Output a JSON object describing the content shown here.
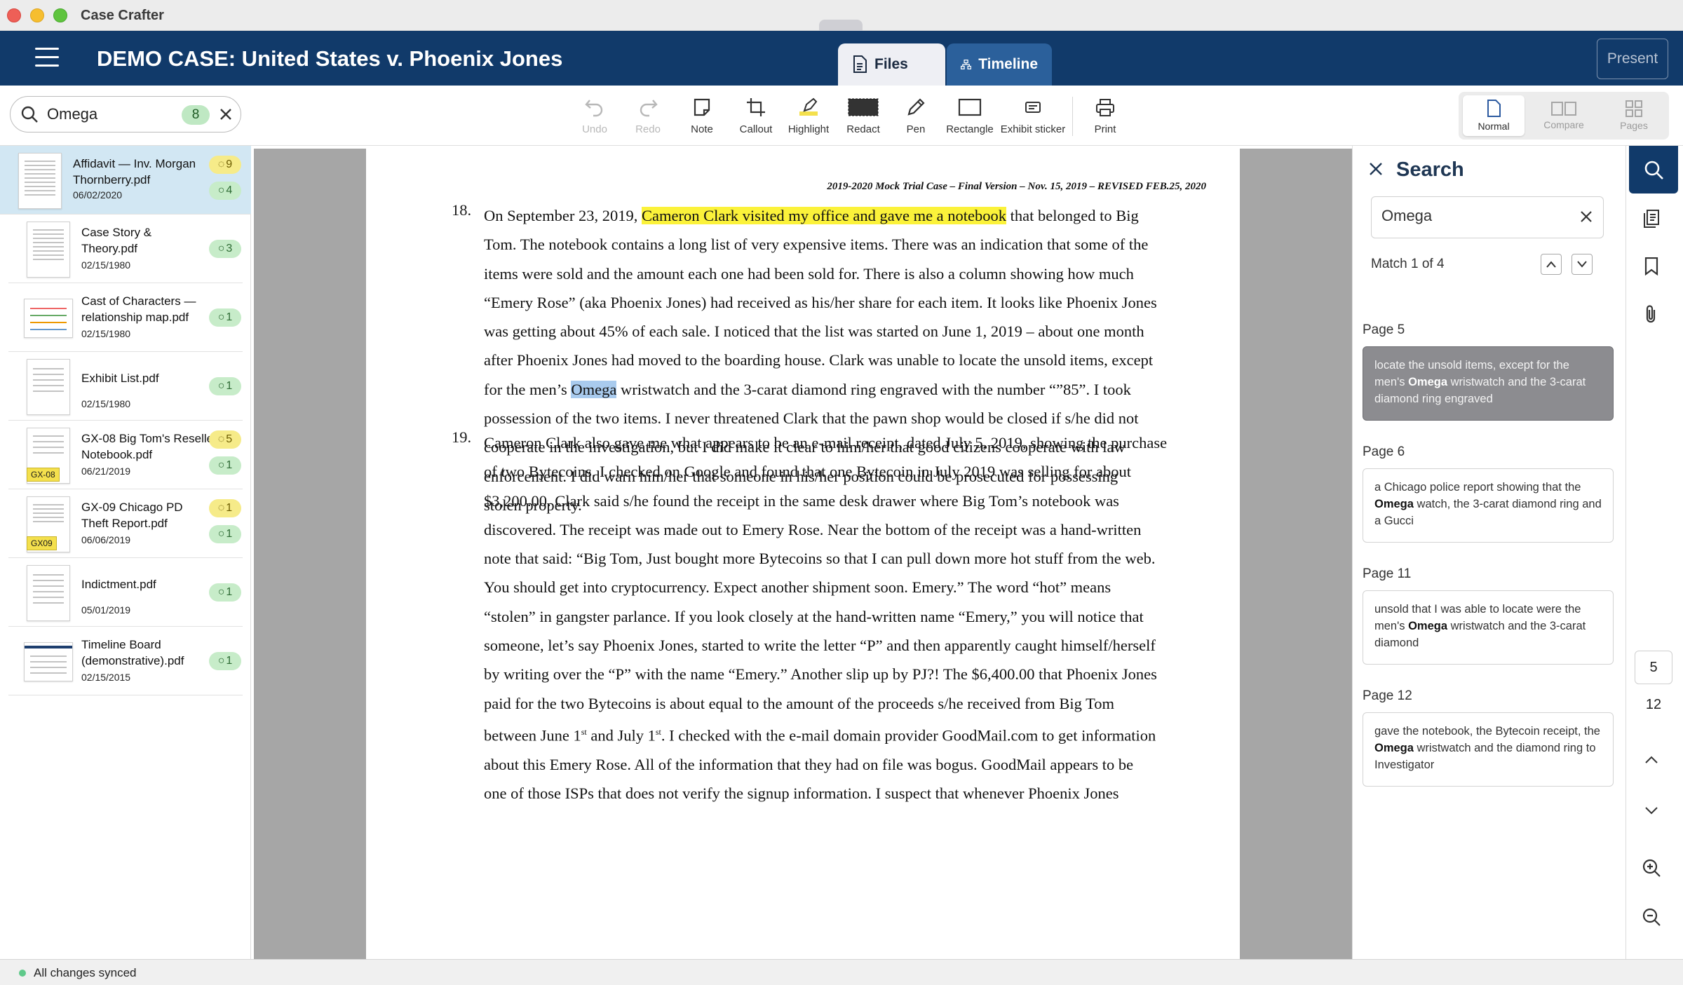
{
  "app": {
    "title": "Case Crafter"
  },
  "header": {
    "case_title": "DEMO CASE: United States v. Phoenix Jones",
    "tabs": [
      {
        "label": "Files",
        "active": true
      },
      {
        "label": "Timeline",
        "active": false
      }
    ],
    "present_label": "Present"
  },
  "file_search": {
    "value": "Omega",
    "count": "8"
  },
  "toolbar": {
    "tools": [
      {
        "label": "Undo",
        "icon": "undo-icon",
        "disabled": true
      },
      {
        "label": "Redo",
        "icon": "redo-icon",
        "disabled": true
      },
      {
        "label": "Note",
        "icon": "note-icon"
      },
      {
        "label": "Callout",
        "icon": "crop-icon"
      },
      {
        "label": "Highlight",
        "icon": "highlighter-icon"
      },
      {
        "label": "Redact",
        "icon": "redact-icon"
      },
      {
        "label": "Pen",
        "icon": "pen-icon"
      },
      {
        "label": "Rectangle",
        "icon": "rectangle-icon"
      },
      {
        "label": "Exhibit sticker",
        "icon": "sticker-icon"
      },
      {
        "label": "Print",
        "icon": "printer-icon"
      }
    ],
    "views": [
      {
        "label": "Normal",
        "active": true
      },
      {
        "label": "Compare",
        "active": false
      },
      {
        "label": "Pages",
        "active": false
      }
    ]
  },
  "files": [
    {
      "name": "Affidavit — Inv. Morgan Thornberry.pdf",
      "date": "06/02/2020",
      "badges": [
        {
          "kind": "yellow",
          "value": "9"
        },
        {
          "kind": "green",
          "value": "4"
        }
      ],
      "selected": true
    },
    {
      "name": "Case Story & Theory.pdf",
      "date": "02/15/1980",
      "badges": [
        {
          "kind": "green",
          "value": "3"
        }
      ]
    },
    {
      "name": "Cast of Characters — relationship map.pdf",
      "date": "02/15/1980",
      "badges": [
        {
          "kind": "green",
          "value": "1"
        }
      ]
    },
    {
      "name": "Exhibit List.pdf",
      "date": "02/15/1980",
      "badges": [
        {
          "kind": "green",
          "value": "1"
        }
      ]
    },
    {
      "name": "GX-08 Big Tom's Reseller Notebook.pdf",
      "date": "06/21/2019",
      "exhibit": "GX-08",
      "badges": [
        {
          "kind": "yellow",
          "value": "5"
        },
        {
          "kind": "green",
          "value": "1"
        }
      ]
    },
    {
      "name": "GX-09 Chicago PD Theft Report.pdf",
      "date": "06/06/2019",
      "exhibit": "GX09",
      "badges": [
        {
          "kind": "yellow",
          "value": "1"
        },
        {
          "kind": "green",
          "value": "1"
        }
      ]
    },
    {
      "name": "Indictment.pdf",
      "date": "05/01/2019",
      "badges": [
        {
          "kind": "green",
          "value": "1"
        }
      ]
    },
    {
      "name": "Timeline Board (demonstrative).pdf",
      "date": "02/15/2015",
      "badges": [
        {
          "kind": "green",
          "value": "1"
        }
      ]
    }
  ],
  "document": {
    "header": "2019-2020 Mock Trial Case – Final Version – Nov. 15, 2019 – REVISED FEB.25, 2020",
    "para18": {
      "number": "18.",
      "l1_pre": "On September 23, 2019, ",
      "l1_highlight": "Cameron Clark visited my office and gave me a notebook",
      "l1_post": " that belonged to Big",
      "l2": "Tom. The notebook contains a long list of very expensive items. There was an indication that some of the",
      "l3": "items were sold and the amount each one had been sold for. There is also a column showing how much",
      "l4": "“Emery Rose” (aka Phoenix Jones) had received as his/her share for each item. It looks like Phoenix Jones",
      "l5": "was getting about 45% of each sale. I noticed that the list was started on June 1, 2019 – about one month",
      "l6": "after Phoenix Jones had moved to the boarding house. Clark was unable to locate the unsold items, except",
      "l7_pre": "for the men’s ",
      "l7_match": "Omega",
      "l7_post": " wristwatch and the 3-carat diamond ring engraved with the number “”85”. I took",
      "l8": "possession of the two items. I never threatened Clark that the pawn shop would be closed if s/he did not",
      "l9": "cooperate in the investigation, but I did make it clear to him/her that good citizens cooperate with law",
      "l10": "enforcement. I did warn him/her that someone in his/her position could be prosecuted for possessing",
      "l11": "stolen property."
    },
    "para19": {
      "number": "19.",
      "l1": "Cameron Clark also gave me what appears to be an e-mail receipt, dated July 5, 2019, showing the purchase",
      "l2": "of two Bytecoins.  I checked on Google and found that one Bytecoin in July 2019 was selling for about",
      "l3": "$3,200.00.  Clark said s/he found the receipt in the same desk drawer where Big Tom’s notebook was",
      "l4": "discovered.  The receipt was made out to Emery Rose.  Near the bottom of the receipt was a hand-written",
      "l5": "note that said: “Big Tom, Just bought more Bytecoins so that I can pull down more hot stuff from the web.",
      "l6": "You should get into cryptocurrency. Expect another shipment soon. Emery.”  The word “hot” means",
      "l7": "“stolen” in gangster parlance.  If you look closely at the hand-written name “Emery,” you will notice that",
      "l8": "someone, let’s say Phoenix Jones, started to write the letter “P” and then apparently caught himself/herself",
      "l9": "by writing over the “P” with the name “Emery.”  Another slip up by PJ?!  The $6,400.00 that Phoenix Jones",
      "l10": "paid for the two Bytecoins is about equal to the amount of the proceeds s/he received from Big Tom",
      "l11_a": "between June 1",
      "l11_sup1": "st",
      "l11_b": " and July 1",
      "l11_sup2": "st",
      "l11_c": ".  I checked with the e-mail domain provider GoodMail.com to get information",
      "l12": "about this Emery Rose.  All of the information that they had on file was bogus.  GoodMail appears to be",
      "l13": "one of those ISPs that does not verify the signup information.  I suspect that whenever Phoenix Jones"
    }
  },
  "search_panel": {
    "title": "Search",
    "query": "Omega",
    "match_text": "Match 1 of 4",
    "results": [
      {
        "page": "Page 5",
        "pre": "locate the unsold items, except for the men's ",
        "match": "Omega",
        "post": " wristwatch and the 3-carat diamond ring engraved",
        "active": true
      },
      {
        "page": "Page 6",
        "pre": "a Chicago police report showing that the ",
        "match": "Omega",
        "post": " watch, the 3-carat diamond ring and a Gucci"
      },
      {
        "page": "Page 11",
        "pre": "unsold that I was able to locate were the men's ",
        "match": "Omega",
        "post": " wristwatch and the 3-carat diamond"
      },
      {
        "page": "Page 12",
        "pre": "gave the notebook, the Bytecoin receipt, the ",
        "match": "Omega",
        "post": " wristwatch and the diamond ring to Investigator"
      }
    ]
  },
  "pager": {
    "current": "5",
    "total": "12"
  },
  "status": {
    "text": "All changes synced"
  }
}
